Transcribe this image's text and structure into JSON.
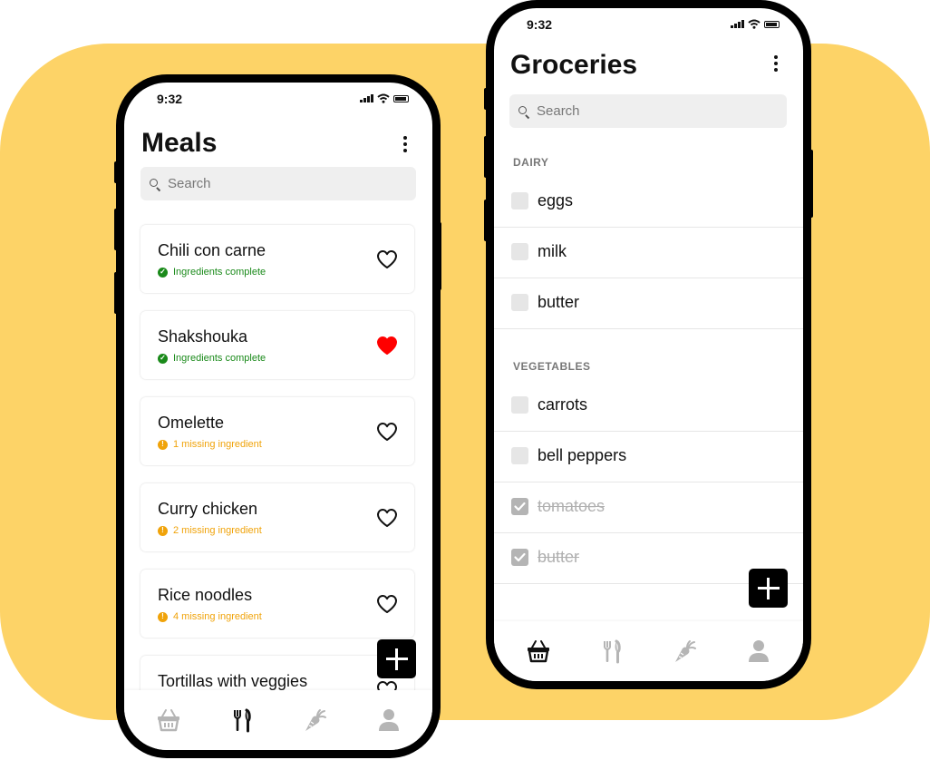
{
  "colors": {
    "background_accent": "#FDD367",
    "heart_filled": "#FF0000",
    "status_complete": "#1A8A1A",
    "status_missing": "#F0A30A"
  },
  "meals_screen": {
    "status_time": "9:32",
    "title": "Meals",
    "search_placeholder": "Search",
    "meals": [
      {
        "name": "Chili con carne",
        "status": "Ingredients complete",
        "status_type": "complete",
        "favorite": false
      },
      {
        "name": "Shakshouka",
        "status": "Ingredients complete",
        "status_type": "complete",
        "favorite": true
      },
      {
        "name": "Omelette",
        "status": "1 missing ingredient",
        "status_type": "missing",
        "favorite": false
      },
      {
        "name": "Curry chicken",
        "status": "2 missing ingredient",
        "status_type": "missing",
        "favorite": false
      },
      {
        "name": "Rice noodles",
        "status": "4 missing ingredient",
        "status_type": "missing",
        "favorite": false
      },
      {
        "name": "Tortillas with veggies",
        "status": "",
        "status_type": "",
        "favorite": false
      }
    ],
    "nav": [
      {
        "icon": "basket-icon",
        "active": false
      },
      {
        "icon": "fork-knife-icon",
        "active": true
      },
      {
        "icon": "carrot-icon",
        "active": false
      },
      {
        "icon": "user-icon",
        "active": false
      }
    ]
  },
  "groceries_screen": {
    "status_time": "9:32",
    "title": "Groceries",
    "search_placeholder": "Search",
    "sections": [
      {
        "label": "DAIRY",
        "items": [
          {
            "name": "eggs",
            "checked": false
          },
          {
            "name": "milk",
            "checked": false
          },
          {
            "name": "butter",
            "checked": false
          }
        ]
      },
      {
        "label": "VEGETABLES",
        "items": [
          {
            "name": "carrots",
            "checked": false
          },
          {
            "name": "bell peppers",
            "checked": false
          },
          {
            "name": "tomatoes",
            "checked": true
          },
          {
            "name": "butter",
            "checked": true
          }
        ]
      }
    ],
    "nav": [
      {
        "icon": "basket-icon",
        "active": true
      },
      {
        "icon": "fork-knife-icon",
        "active": false
      },
      {
        "icon": "carrot-icon",
        "active": false
      },
      {
        "icon": "user-icon",
        "active": false
      }
    ]
  }
}
